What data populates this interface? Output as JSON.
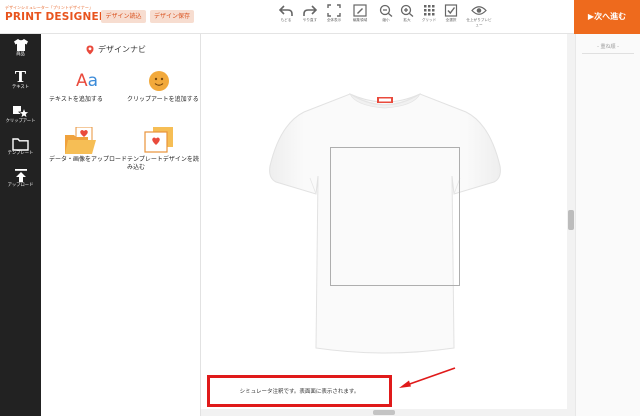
{
  "header": {
    "logo_sub": "デザインシミュレーター「プリントデザイナー」",
    "logo_main": "PRINT DESIGNER",
    "load_button": "デザイン読込",
    "save_button": "デザイン保存",
    "tools": [
      {
        "icon": "undo-icon",
        "label": "もどる"
      },
      {
        "icon": "redo-icon",
        "label": "やり直す"
      },
      {
        "icon": "fullscreen-icon",
        "label": "全体表示"
      },
      {
        "icon": "edit-area-icon",
        "label": "編集領域"
      },
      {
        "icon": "zoom-out-icon",
        "label": "縮小"
      },
      {
        "icon": "zoom-in-icon",
        "label": "拡大"
      },
      {
        "icon": "grid-icon",
        "label": "グリッド"
      },
      {
        "icon": "check-icon",
        "label": "全選択"
      },
      {
        "icon": "preview-icon",
        "label": "仕上がりプレビュー"
      }
    ],
    "next_button": "▶次へ進む",
    "colors": {
      "accent": "#ee6a1d",
      "logo": "#e8541e",
      "button_bg": "#f7ddd0"
    }
  },
  "leftbar": {
    "items": [
      {
        "icon": "tshirt-icon",
        "label": "商品"
      },
      {
        "icon": "text-icon",
        "glyph": "T",
        "label": "テキスト"
      },
      {
        "icon": "clipart-icon",
        "label": "クリップアート"
      },
      {
        "icon": "folder-icon",
        "label": "テンプレート"
      },
      {
        "icon": "upload-icon",
        "label": "アップロード"
      }
    ]
  },
  "panel": {
    "title": "デザインナビ",
    "items": [
      {
        "icon": "add-text-icon",
        "glyph_a": "A",
        "glyph_b": "a",
        "label": "テキストを追加する"
      },
      {
        "icon": "smiley-icon",
        "label": "クリップアートを追加する"
      },
      {
        "icon": "image-upload-icon",
        "label": "データ・画像をアップロード"
      },
      {
        "icon": "template-icon",
        "label": "テンプレートデザインを読み込む"
      }
    ]
  },
  "right_panel": {
    "label": "- 重ね順 -"
  },
  "notice": {
    "text": "シミュレータ注釈です。表面面に表示されます。",
    "border_color": "#e01a1a"
  }
}
